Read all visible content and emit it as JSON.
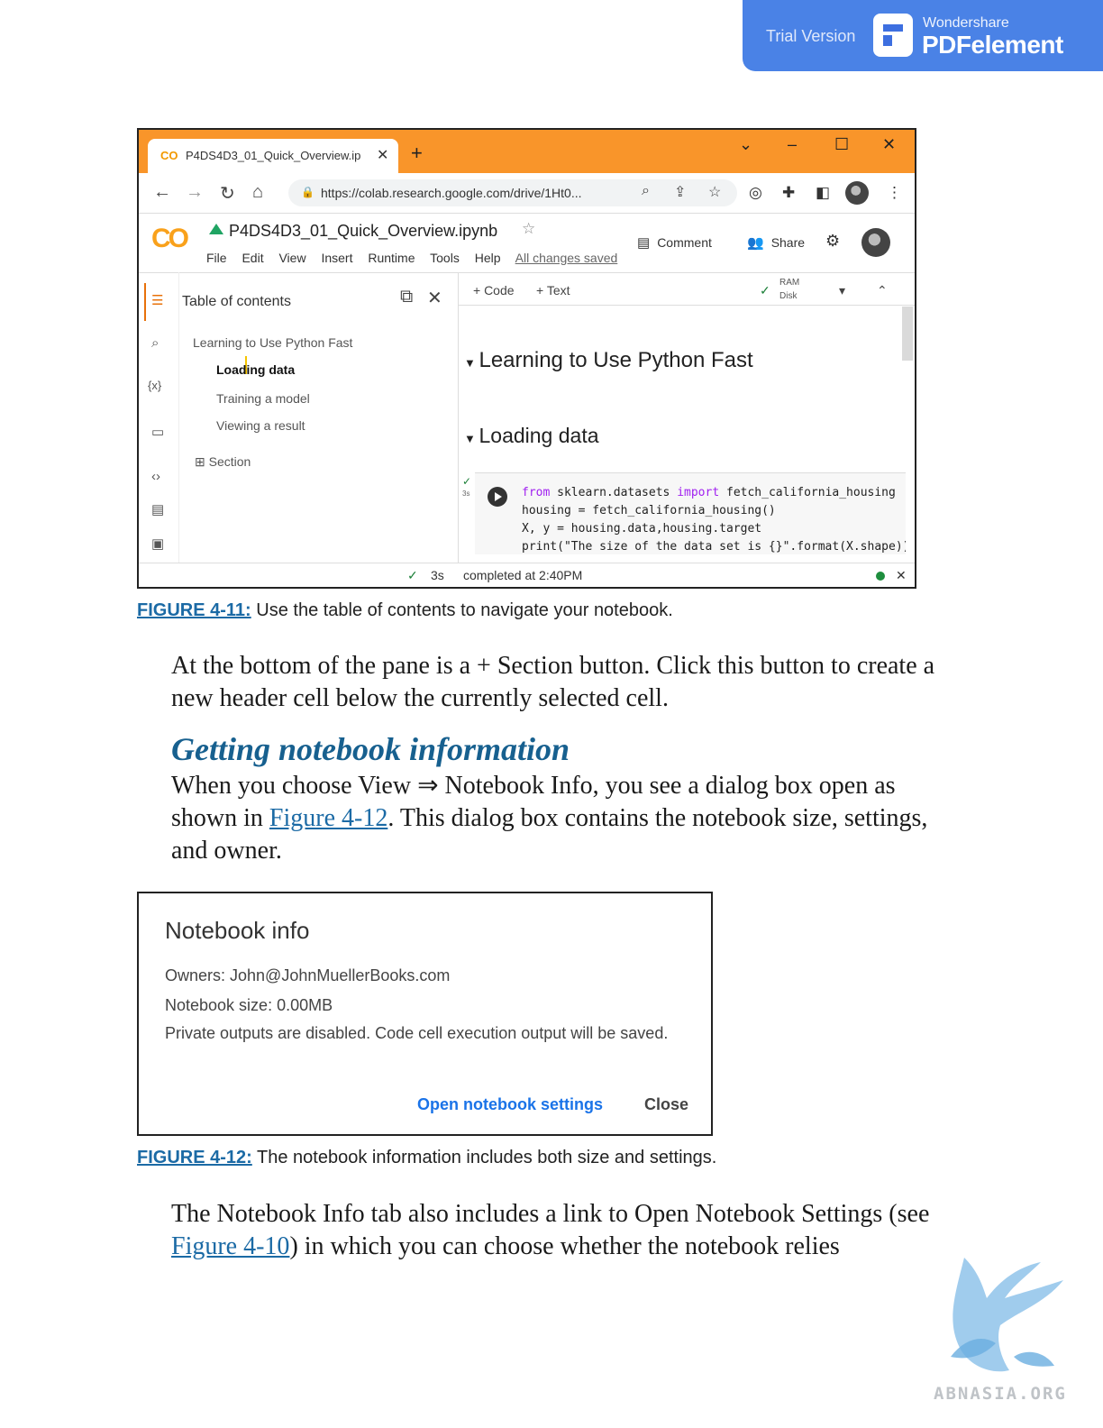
{
  "trial_banner": {
    "trial_text": "Trial Version",
    "brand_top": "Wondershare",
    "brand_name": "PDFelement"
  },
  "figure1": {
    "tab_title": "P4DS4D3_01_Quick_Overview.ip",
    "url": "https://colab.research.google.com/drive/1Ht0...",
    "notebook_name": "P4DS4D3_01_Quick_Overview.ipynb",
    "menu": [
      "File",
      "Edit",
      "View",
      "Insert",
      "Runtime",
      "Tools",
      "Help"
    ],
    "all_changes_saved": "All changes saved",
    "comment_label": "Comment",
    "share_label": "Share",
    "toc_title": "Table of contents",
    "toc_items": [
      "Learning to Use Python Fast",
      "Loading data",
      "Training a model",
      "Viewing a result"
    ],
    "section_label": "Section",
    "add_code": "+ Code",
    "add_text": "+ Text",
    "ram_label": "RAM",
    "disk_label": "Disk",
    "heading1": "Learning to Use Python Fast",
    "heading2": "Loading data",
    "code_line2": "housing = fetch_california_housing()",
    "code_line3": "X, y = housing.data,housing.target",
    "exec_time": "3s",
    "status_time": "3s",
    "status_text": "completed at 2:40PM"
  },
  "caption1": {
    "label": "FIGURE 4-11:",
    "text": " Use the table of contents to navigate your notebook."
  },
  "para1": "At the bottom of the pane is a + Section button. Click this button to create a new header cell below the currently selected cell.",
  "subheading": "Getting notebook information",
  "para2": {
    "part1": "When you choose View ⇒ Notebook Info, you see a dialog box open as shown in ",
    "link": "Figure 4-12",
    "part2": ". This dialog box contains the notebook size, settings, and owner."
  },
  "figure2": {
    "title": "Notebook info",
    "owners": "Owners: John@JohnMuellerBooks.com",
    "size": "Notebook size: 0.00MB",
    "private": "Private outputs are disabled. Code cell execution output will be saved.",
    "open_settings": "Open notebook settings",
    "close": "Close"
  },
  "caption2": {
    "label": "FIGURE 4-12:",
    "text": " The notebook information includes both size and settings."
  },
  "para3": {
    "part1": "The Notebook Info tab also includes a link to Open Notebook Settings (see ",
    "link": "Figure 4-10",
    "part2": ") in which you can choose whether the notebook relies"
  },
  "watermark": "ABNASIA.ORG"
}
